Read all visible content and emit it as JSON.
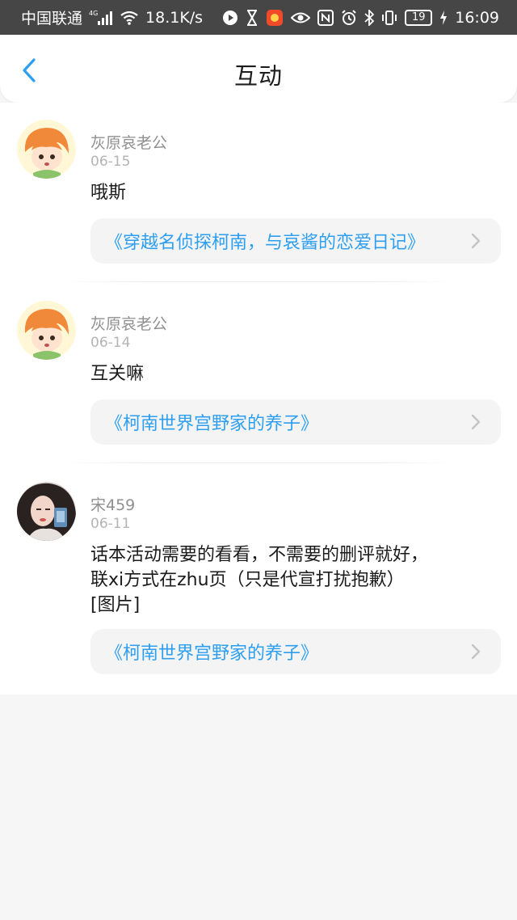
{
  "status_bar": {
    "carrier": "中国联通",
    "network_type": "4G",
    "net_speed": "18.1K/s",
    "battery_level": "19",
    "time": "16:09",
    "icons": [
      "signal-icon",
      "wifi-icon",
      "play-icon",
      "hourglass-icon",
      "app-icon",
      "eye-icon",
      "nfc-icon",
      "alarm-icon",
      "bluetooth-icon",
      "vibrate-icon",
      "battery-icon",
      "charging-icon"
    ]
  },
  "header": {
    "title": "互动",
    "back_icon": "chevron-left-icon"
  },
  "colors": {
    "accent": "#2e9ff0",
    "status_bar_bg": "#464646",
    "page_bg": "#f7f6f7"
  },
  "interactions": [
    {
      "username": "灰原哀老公",
      "date": "06-15",
      "comment_lines": [
        "哦斯"
      ],
      "book_title": "《穿越名侦探柯南，与哀酱的恋爱日记》",
      "avatar_icon": "cartoon-avatar"
    },
    {
      "username": "灰原哀老公",
      "date": "06-14",
      "comment_lines": [
        "互关嘛"
      ],
      "book_title": "《柯南世界宫野家的养子》",
      "avatar_icon": "cartoon-avatar"
    },
    {
      "username": "宋459",
      "date": "06-11",
      "comment_lines": [
        "话本活动需要的看看，不需要的删评就好，",
        "联xi方式在zhu页（只是代宣打扰抱歉）",
        "[图片]"
      ],
      "book_title": "《柯南世界宫野家的养子》",
      "avatar_icon": "photo-avatar"
    }
  ]
}
